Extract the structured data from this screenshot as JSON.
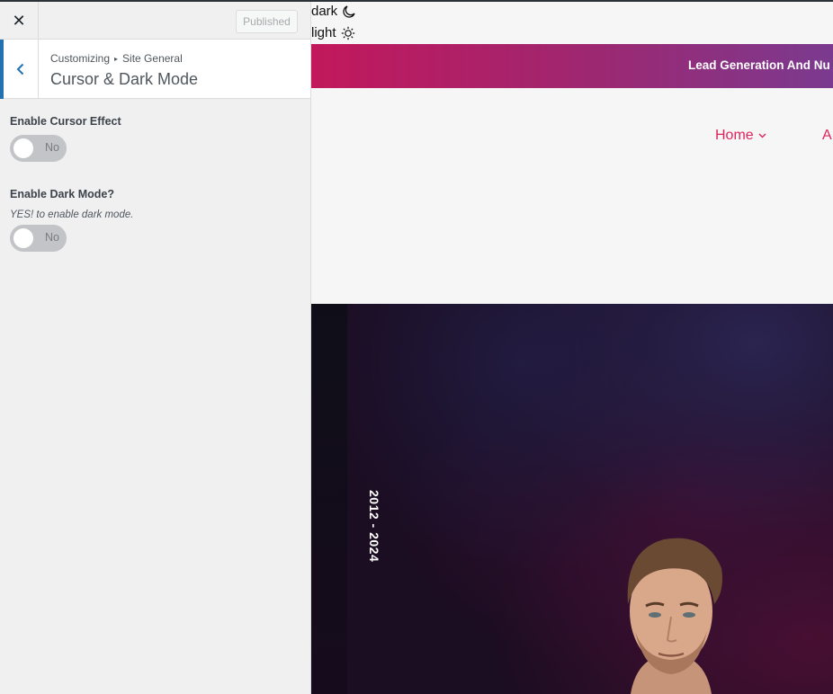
{
  "customizer": {
    "publish_label": "Published",
    "breadcrumb": {
      "root": "Customizing",
      "section": "Site General"
    },
    "section_title": "Cursor & Dark Mode",
    "controls": [
      {
        "label": "Enable Cursor Effect",
        "description": "",
        "toggle_state": "No"
      },
      {
        "label": "Enable Dark Mode?",
        "description": "YES! to enable dark mode.",
        "toggle_state": "No"
      }
    ],
    "accent_color": "#2271b1"
  },
  "preview": {
    "dark_label": "dark",
    "light_label": "light",
    "banner_text": "Lead Generation And Nu",
    "banner_colors": [
      "#c2185b",
      "#7b3a8f"
    ],
    "nav_items": [
      {
        "label": "Home",
        "color": "#e0245e"
      },
      {
        "label": "A",
        "color": "#e0245e"
      }
    ],
    "hero_years": "2012 - 2024"
  }
}
